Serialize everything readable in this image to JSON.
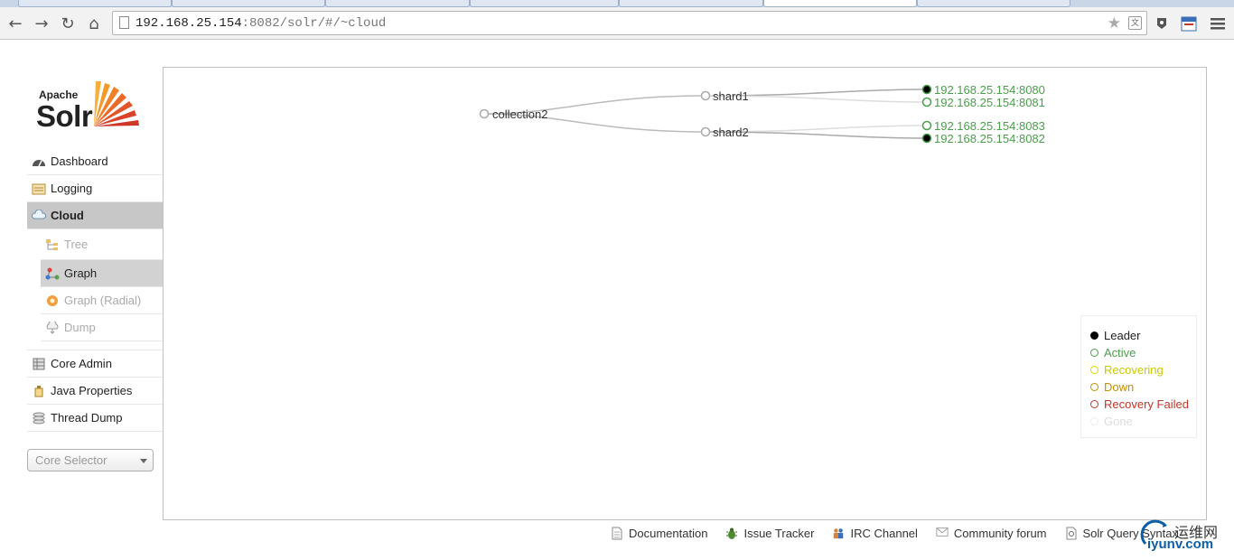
{
  "browser": {
    "url_host": "192.168.25.154",
    "url_rest": ":8082/solr/#/~cloud"
  },
  "logo": {
    "apache": "Apache",
    "solr": "Solr"
  },
  "menu": {
    "dashboard": "Dashboard",
    "logging": "Logging",
    "cloud": "Cloud",
    "tree": "Tree",
    "graph": "Graph",
    "graph_radial": "Graph (Radial)",
    "dump": "Dump",
    "core_admin": "Core Admin",
    "java_properties": "Java Properties",
    "thread_dump": "Thread Dump"
  },
  "core_selector": {
    "placeholder": "Core Selector"
  },
  "graph": {
    "collection": "collection2",
    "shards": [
      "shard1",
      "shard2"
    ],
    "replicas": [
      {
        "address": "192.168.25.154:8080",
        "shard": "shard1",
        "leader": true
      },
      {
        "address": "192.168.25.154:8081",
        "shard": "shard1",
        "leader": false
      },
      {
        "address": "192.168.25.154:8083",
        "shard": "shard2",
        "leader": false
      },
      {
        "address": "192.168.25.154:8082",
        "shard": "shard2",
        "leader": true
      }
    ]
  },
  "legend": {
    "leader": "Leader",
    "active": "Active",
    "recovering": "Recovering",
    "down": "Down",
    "recovery_failed": "Recovery Failed",
    "gone": "Gone"
  },
  "colors": {
    "leader": "#000000",
    "active": "#4b9e4b",
    "recovering": "#d8d800",
    "down": "#c48f00",
    "recovery_failed": "#c0392b",
    "gone": "#e5e5e5"
  },
  "footer": {
    "documentation": "Documentation",
    "issue_tracker": "Issue Tracker",
    "irc_channel": "IRC Channel",
    "community_forum": "Community forum",
    "query_syntax": "Solr Query Syntax"
  },
  "watermark": {
    "top": "运维网",
    "bottom": "iyunv.com"
  }
}
